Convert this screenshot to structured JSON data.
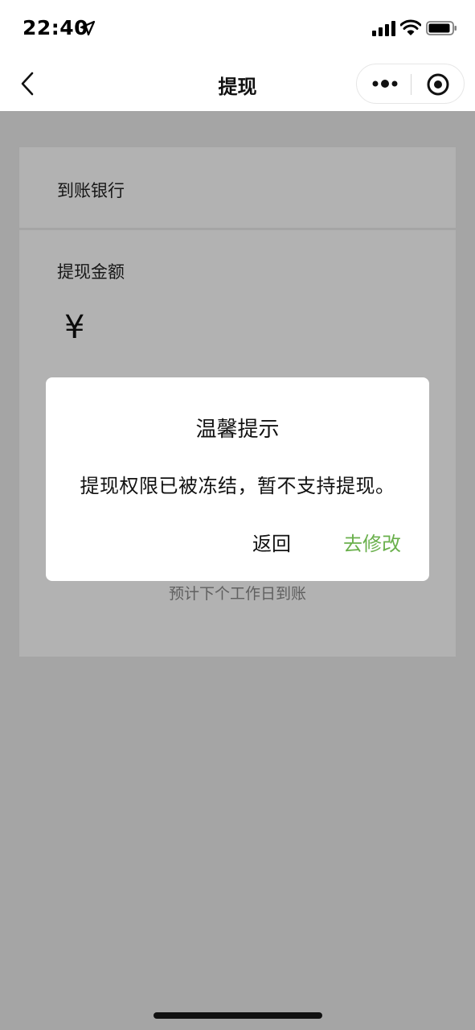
{
  "status_bar": {
    "time": "22:40",
    "icons": [
      "location-arrow-icon",
      "cellular-signal-icon",
      "wifi-icon",
      "battery-icon"
    ]
  },
  "nav": {
    "title": "提现",
    "icons": [
      "back-chevron-icon",
      "more-dots-icon",
      "close-circle-icon"
    ]
  },
  "form": {
    "bank_label": "到账银行",
    "amount_label": "提现金额",
    "currency_symbol": "¥",
    "eta_text": "预计下个工作日到账"
  },
  "dialog": {
    "title": "温馨提示",
    "message": "提现权限已被冻结，暂不支持提现。",
    "cancel_label": "返回",
    "confirm_label": "去修改"
  },
  "colors": {
    "accent_green": "#6ab04c",
    "overlay": "rgba(0,0,0,0.30)",
    "background": "#ededed"
  }
}
